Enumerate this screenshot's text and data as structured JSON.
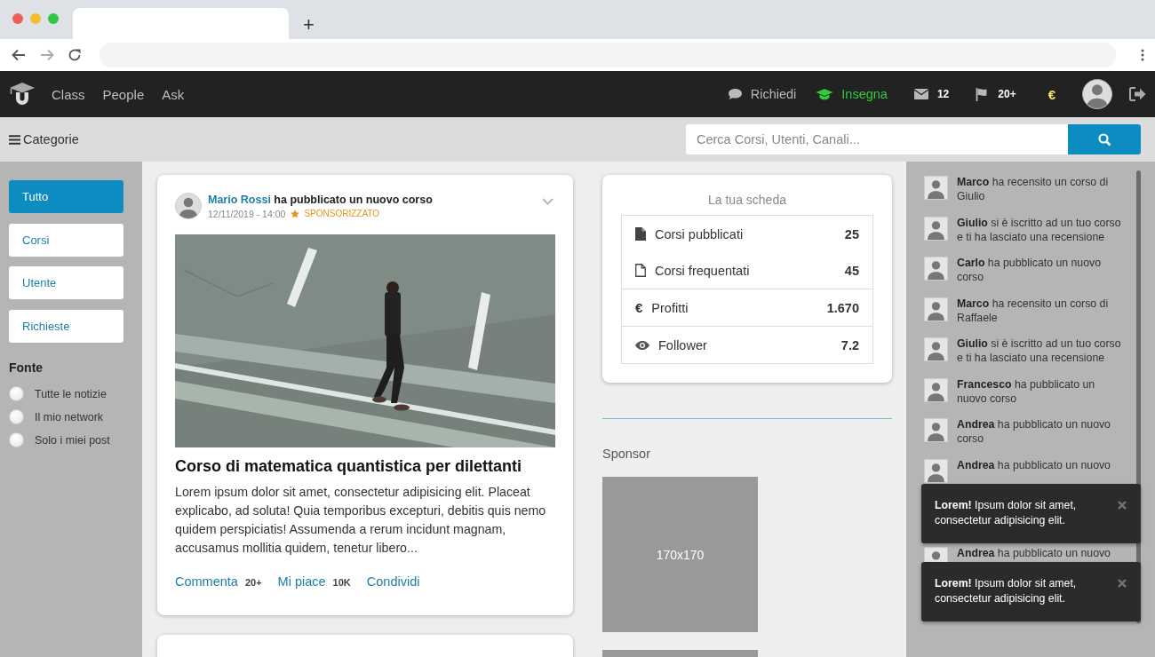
{
  "browser": {
    "new_tab": "+"
  },
  "nav": {
    "links": [
      {
        "label": "Class"
      },
      {
        "label": "People"
      },
      {
        "label": "Ask"
      }
    ],
    "actions": [
      {
        "kind": "request",
        "label": "Richiedi",
        "color": "#b8b8b8"
      },
      {
        "kind": "teach",
        "label": "Insegna",
        "color": "#2ecc40"
      },
      {
        "kind": "messages",
        "label": "12",
        "color": "#ffffff"
      },
      {
        "kind": "flags",
        "label": "20+",
        "color": "#ffffff"
      },
      {
        "kind": "wallet",
        "label": "€",
        "color": "#f4e66a"
      }
    ]
  },
  "subbar": {
    "menu_label": "Categorie",
    "search": {
      "placeholder": "Cerca Corsi, Utenti, Canali..."
    }
  },
  "filters": [
    {
      "label": "Tutto",
      "selected": true
    },
    {
      "label": "Corsi",
      "selected": false
    },
    {
      "label": "Utente",
      "selected": false
    },
    {
      "label": "Richieste",
      "selected": false
    }
  ],
  "source": {
    "title": "Fonte",
    "options": [
      {
        "label": "Tutte le notizie",
        "selected": false
      },
      {
        "label": "Il mio network",
        "selected": false
      },
      {
        "label": "Solo i miei post",
        "selected": false
      }
    ]
  },
  "post": {
    "author": "Mario Rossi",
    "action": "ha pubblicato un nuovo corso",
    "date": "12/11/2019 - 14:00",
    "sponsored_label": "SPONSORIZZATO",
    "title": "Corso di matematica quantistica per dilettanti",
    "body": "Lorem ipsum dolor sit amet, consectetur adipisicing elit. Placeat explicabo, ad soluta! Quia temporibus excepturi, debitis quis nemo quidem perspiciatis! Assumenda a rerum incidunt magnam, accusamus mollitia quidem, tenetur libero...",
    "actions": [
      {
        "label": "Commenta",
        "count": "20+"
      },
      {
        "label": "Mi piace",
        "count": "10K"
      },
      {
        "label": "Condividi"
      }
    ]
  },
  "profile_card": {
    "title": "La tua scheda",
    "stats": [
      {
        "kind": "published",
        "label": "Corsi pubblicati",
        "value": "25"
      },
      {
        "kind": "attended",
        "label": "Corsi frequentati",
        "value": "45"
      },
      {
        "kind": "profits",
        "symbol": "€",
        "label": "Profitti",
        "value": "1.670"
      },
      {
        "kind": "followers",
        "label": "Follower",
        "value": "7.2"
      }
    ]
  },
  "sponsor": {
    "title": "Sponsor",
    "ads": [
      {
        "kind": "placeholder",
        "label": "170x170"
      },
      {
        "kind": "placeholder"
      }
    ]
  },
  "activity": [
    {
      "text": "**Marco** ha recensito un corso di Giulio"
    },
    {
      "text": "**Giulio** si è iscritto ad un tuo corso e ti ha lasciato una recensione"
    },
    {
      "text": "**Carlo** ha pubblicato un nuovo corso"
    },
    {
      "text": "**Marco** ha recensito un corso di Raffaele"
    },
    {
      "text": "**Giulio** si è iscritto ad un tuo corso e ti ha lasciato una recensione"
    },
    {
      "text": "**Francesco** ha pubblicato un nuovo corso"
    },
    {
      "text": "**Andrea** ha pubblicato un nuovo corso"
    },
    {
      "text": "**Andrea** ha pubblicato un nuovo"
    },
    {
      "text": "**Andrea** ha pubblicato un nuovo"
    }
  ],
  "toasts": [
    {
      "text": "**Lorem!** Ipsum dolor sit amet, consectetur adipisicing elit."
    },
    {
      "text": "**Lorem!** Ipsum dolor sit amet, consectetur adipisicing elit."
    }
  ]
}
